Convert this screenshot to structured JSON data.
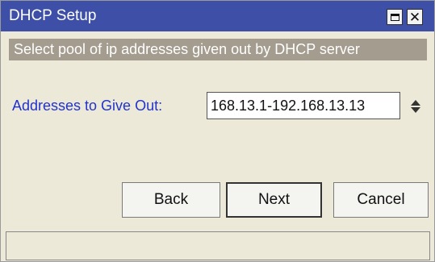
{
  "window": {
    "title": "DHCP Setup",
    "titlebar_color": "#3d4fa6",
    "controls": [
      "maximize-icon",
      "close-icon"
    ]
  },
  "banner": {
    "text": "Select pool of ip addresses given out by DHCP server"
  },
  "form": {
    "addresses_label": "Addresses to Give Out:",
    "addresses_value": "168.13.1-192.168.13.13"
  },
  "buttons": {
    "back": "Back",
    "next": "Next",
    "cancel": "Cancel"
  },
  "status_bar": {
    "text": ""
  }
}
